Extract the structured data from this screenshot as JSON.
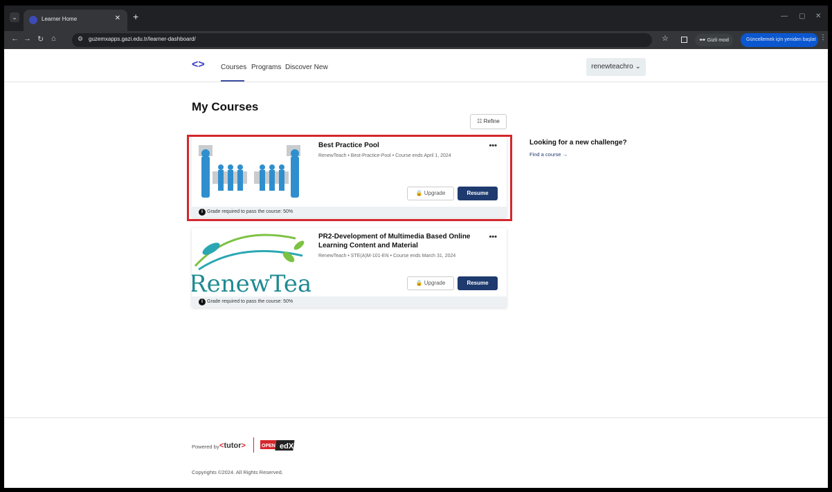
{
  "browser": {
    "tab_title": "Learner Home",
    "url": "guzemxapps.gazi.edu.tr/learner-dashboard/",
    "incognito_label": "Gizli mod",
    "update_label": "Güncellemek için yeniden başlat"
  },
  "header": {
    "nav": [
      "Courses",
      "Programs",
      "Discover New"
    ],
    "username": "renewteachro"
  },
  "main": {
    "title": "My Courses",
    "refine_label": "Refine",
    "courses": [
      {
        "title": "Best Practice Pool",
        "meta": "RenewTeach • Best-Practice-Pool • Course ends April 1, 2024",
        "upgrade_label": "Upgrade",
        "resume_label": "Resume",
        "grade_note": "Grade required to pass the course: 50%"
      },
      {
        "title": "PR2-Development of Multimedia Based Online Learning Content and Material",
        "meta": "RenewTeach • STE(A)M-101-EN • Course ends March 31, 2024",
        "upgrade_label": "Upgrade",
        "resume_label": "Resume",
        "grade_note": "Grade required to pass the course: 50%",
        "thumb_text": "RenewTeach"
      }
    ]
  },
  "sidebar": {
    "title": "Looking for a new challenge?",
    "link": "Find a course"
  },
  "footer": {
    "powered_by": "Powered by",
    "tutor_brand": "tutor",
    "openedx_top": "OPEN",
    "openedx_bottom": "edX",
    "copyright": "Copyrights ©2024. All Rights Reserved."
  },
  "colors": {
    "brand": "#3d3bbf",
    "button_primary": "#1e3a6e",
    "highlight": "#d4262c"
  }
}
